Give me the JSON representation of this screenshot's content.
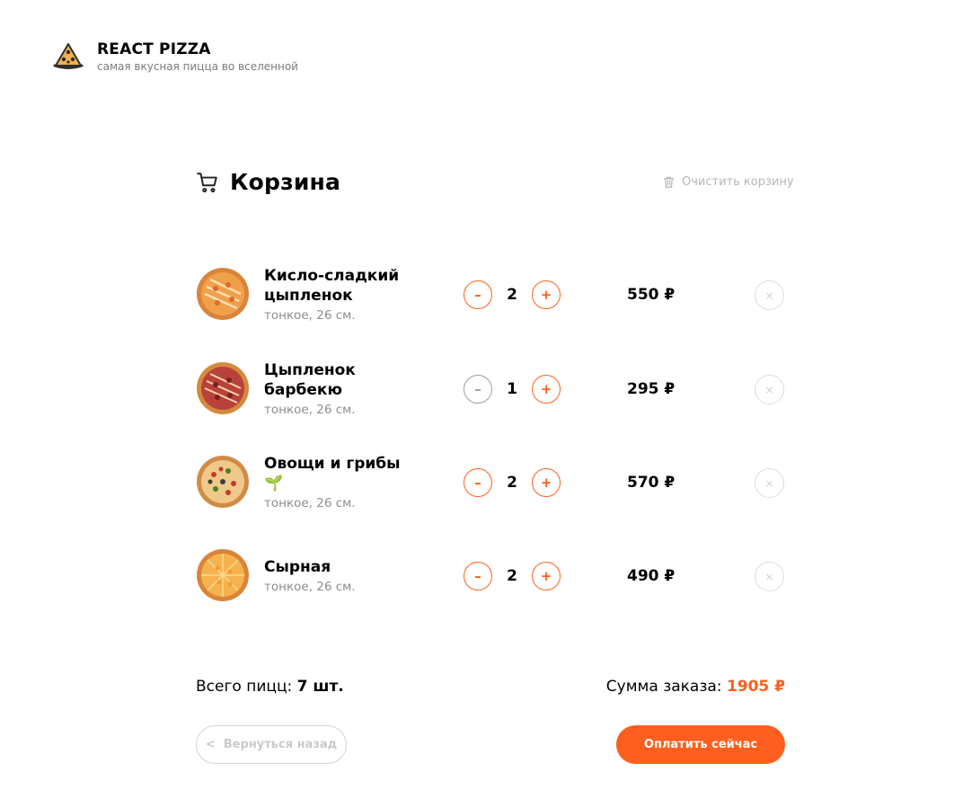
{
  "header": {
    "title": "REACT PIZZA",
    "subtitle": "самая вкусная пицца во вселенной",
    "logo_icon": "pizza-slice-icon"
  },
  "cart": {
    "title": "Корзина",
    "cart_icon": "shopping-cart-icon",
    "clear_label": "Очистить корзину",
    "clear_icon": "trash-icon"
  },
  "items": [
    {
      "name_line1": "Кисло-сладкий",
      "name_line2": "цыпленок",
      "desc": "тонкое, 26 см.",
      "count": "2",
      "price": "550 ₽",
      "minus": "–",
      "plus": "+",
      "remove": "×",
      "minus_disabled": false
    },
    {
      "name_line1": "Цыпленок",
      "name_line2": "барбекю",
      "desc": "тонкое, 26 см.",
      "count": "1",
      "price": "295 ₽",
      "minus": "–",
      "plus": "+",
      "remove": "×",
      "minus_disabled": true
    },
    {
      "name_line1": "Овощи и грибы",
      "name_line2": "🌱",
      "desc": "тонкое, 26 см.",
      "count": "2",
      "price": "570 ₽",
      "minus": "–",
      "plus": "+",
      "remove": "×",
      "minus_disabled": false
    },
    {
      "name_line1": "Сырная",
      "name_line2": "",
      "desc": "тонкое, 26 см.",
      "count": "2",
      "price": "490 ₽",
      "minus": "–",
      "plus": "+",
      "remove": "×",
      "minus_disabled": false
    }
  ],
  "totals": {
    "count_label": "Всего пицц:",
    "count_value": "7 шт.",
    "sum_label": "Сумма заказа:",
    "sum_value": "1905 ₽"
  },
  "actions": {
    "back_chevron": "<",
    "back_label": "Вернуться назад",
    "pay_label": "Оплатить сейчас"
  },
  "colors": {
    "accent": "#fe5f1e",
    "muted": "#8d8d8d"
  }
}
